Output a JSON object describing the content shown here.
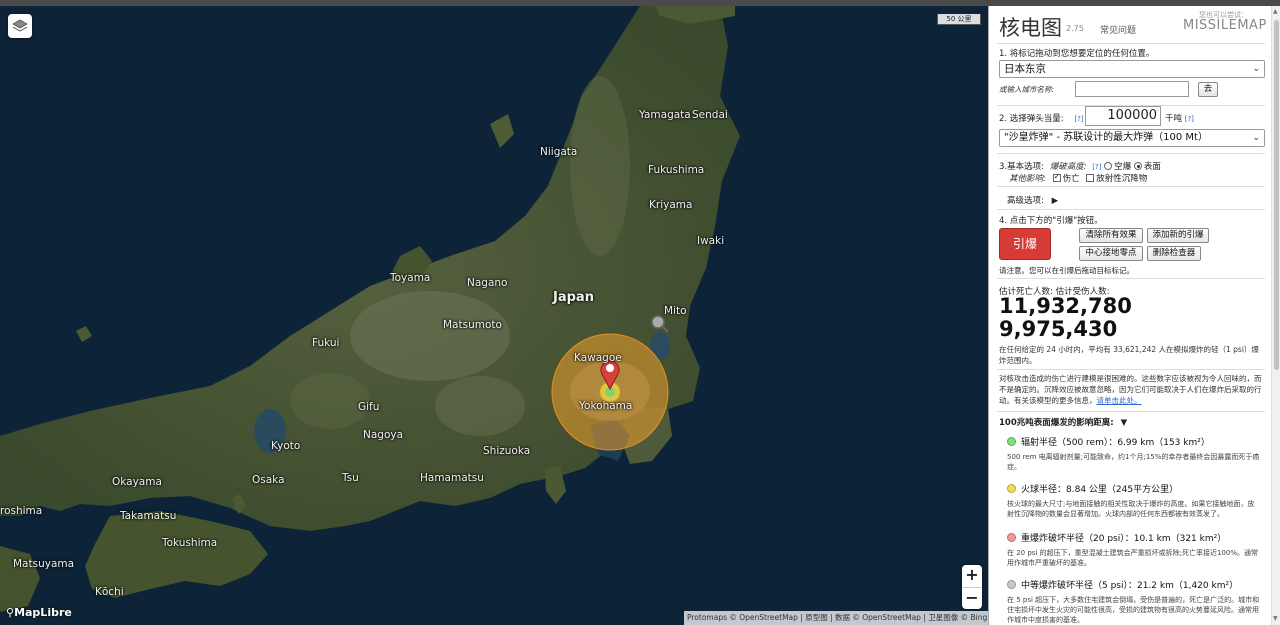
{
  "map": {
    "scale_label": "50 公里",
    "zoom_in": "+",
    "zoom_out": "−",
    "logo": "MapLibre",
    "attribution": "Protomaps © OpenStreetMap | 原型图 | 数据 © OpenStreetMap | 卫星图像 © Bing 地图",
    "places": {
      "yamagata": "Yamagata",
      "sendai": "Sendai",
      "niigata": "Niigata",
      "fukushima": "Fukushima",
      "kriyama": "Kriyama",
      "iwaki": "Iwaki",
      "toyama": "Toyama",
      "nagano": "Nagano",
      "japan": "Japan",
      "mito": "Mito",
      "matsumoto": "Matsumoto",
      "fukui": "Fukui",
      "kawagoe": "Kawagoe",
      "yokohama": "Yokohama",
      "gifu": "Gifu",
      "nagoya": "Nagoya",
      "kyoto": "Kyoto",
      "shizuoka": "Shizuoka",
      "okayama": "Okayama",
      "osaka": "Osaka",
      "tsu": "Tsu",
      "hamamatsu": "Hamamatsu",
      "hiroshima": "roshima",
      "takamatsu": "Takamatsu",
      "tokushima": "Tokushima",
      "matsuyama": "Matsuyama",
      "kochi": "Kōchi"
    }
  },
  "panel": {
    "title": "核电图",
    "version": "2.75",
    "faq": "常见问题",
    "also": "您也可以尝试：",
    "missilemap": "MISSILEMAP",
    "step1": "1. 将标记拖动到您想要定位的任何位置。",
    "location_value": "日本东京",
    "city_label": "或输入城市名称:",
    "city_value": "",
    "go": "去",
    "step2": "2. 选择弹头当量:",
    "help": "[?]",
    "yield_value": "100000",
    "yield_unit": "千吨",
    "preset_value": "\"沙皇炸弹\" - 苏联设计的最大炸弹（100 Mt）",
    "step3": "3.基本选项:",
    "burst_label": "爆破高度:",
    "airburst": "空爆",
    "surface": "表面",
    "other_effects": "其他影响:",
    "casualties": "伤亡",
    "fallout": "放射性沉降物",
    "advanced": "高级选项:",
    "advanced_arrow": "▶",
    "step4": "4. 点击下方的\"引爆\"按钮。",
    "detonate": "引爆",
    "clear_effects": "清除所有效果",
    "add_detonation": "添加新的引爆",
    "center_gz": "中心接地零点",
    "delete_probe": "删除检查器",
    "note": "请注意。您可以在引爆后拖动目标标记。",
    "est_label": "估计死亡人数:  估计受伤人数:",
    "deaths": "11,932,780",
    "injuries": "9,975,430",
    "pop_text": "在任何给定的 24 小时内，平均有 33,621,242 人在模拟爆炸的轻（1 psi）爆炸范围内。",
    "disclaimer": "对核攻击造成的伤亡进行建模是很困难的。这些数字应该被视为令人回味的，而不是确定的。沉降效应被故意忽略，因为它们可能取决于人们在爆炸后采取的行动。有关该模型的更多信息，",
    "disclaimer_link": "请单击此处。",
    "effects_title": "100兆吨表面爆发的影响距离:",
    "effects_arrow": "▼",
    "effects": [
      {
        "color": "#7ee07a",
        "head": "辐射半径（500 rem）：6.99 km（153 km²）",
        "desc": "500 rem 电离辐射剂量;可能致命，约1个月;15%的幸存者最终会因暴露而死于癌症。"
      },
      {
        "color": "#f4dc52",
        "head": "火球半径：8.84 公里（245平方公里）",
        "desc": "核火球的最大尺寸;与地面接触的相关性取决于爆炸的高度。如果它接触地面，放射性沉降物的数量会显著增加。火球内部的任何东西都被有效蒸发了。"
      },
      {
        "color": "#f29a9a",
        "head": "重爆炸破坏半径（20 psi）：10.1 km（321 km²）",
        "desc": "在 20 psi 的超压下，重型混凝土建筑会严重损坏或拆除;死亡率接近100%。通常用作城市严重破坏的基准。"
      },
      {
        "color": "#c8c8c8",
        "head": "中等爆炸破坏半径（5 psi）：21.2 km（1,420 km²）",
        "desc": "在 5 psi 超压下，大多数住宅建筑会倒塌，受伤是普遍的，死亡是广泛的。城市和住宅损坏中发生火灾的可能性很高，受损的建筑物有很高的火势蔓延风险。通常用作城市中度损害的基准。"
      }
    ]
  }
}
